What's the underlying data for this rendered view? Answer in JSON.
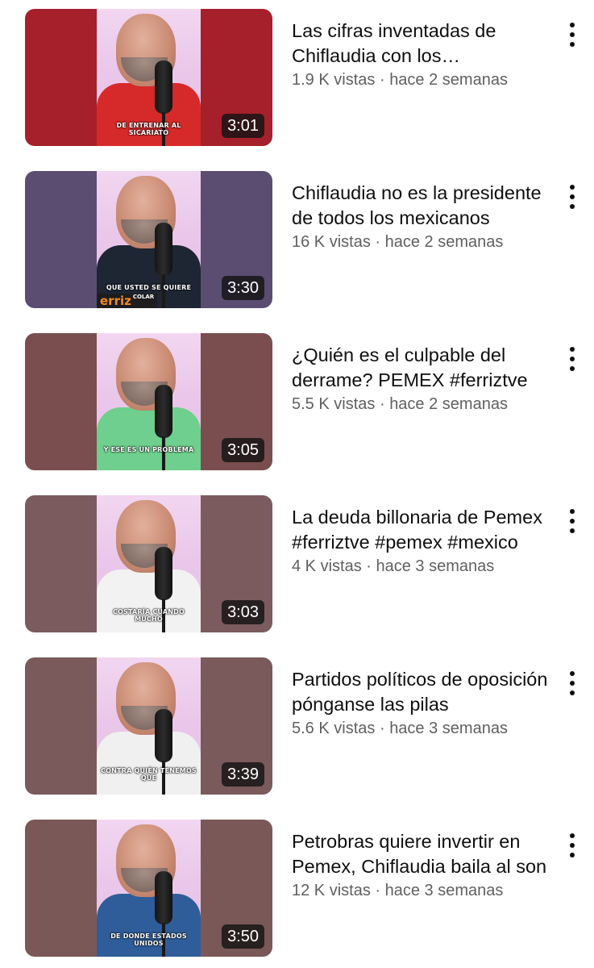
{
  "videos": [
    {
      "title": "Las cifras inventadas de Chiflaudia con los desaparecidos",
      "views": "1.9 K vistas",
      "age": "hace 2 semanas",
      "duration": "3:01",
      "caption": "DE ENTRENAR AL SICARIATO",
      "side_color": "#a5202a",
      "shirt_color": "#d62a2a"
    },
    {
      "title": "Chiflaudia no es la presidente de todos los mexicanos",
      "views": "16 K vistas",
      "age": "hace 2 semanas",
      "duration": "3:30",
      "caption": "QUE USTED SE QUIERE",
      "logo": "erriz",
      "sub_caption": "COLAR",
      "side_color": "#5b4d72",
      "shirt_color": "#1e2533"
    },
    {
      "title": "¿Quién es el culpable del derrame? PEMEX #ferriztve",
      "views": "5.5 K vistas",
      "age": "hace 2 semanas",
      "duration": "3:05",
      "caption": "Y ESE ES UN PROBLEMA",
      "side_color": "#7a4e4e",
      "shirt_color": "#6fcf8e"
    },
    {
      "title": "La deuda billonaria de Pemex #ferriztve #pemex #mexico",
      "views": "4 K vistas",
      "age": "hace 3 semanas",
      "duration": "3:03",
      "caption": "COSTARÍA CUANDO MUCHO",
      "side_color": "#7b5b5d",
      "shirt_color": "#f2f2f2"
    },
    {
      "title": "Partidos políticos de oposición pónganse las pilas",
      "views": "5.6 K vistas",
      "age": "hace 3 semanas",
      "duration": "3:39",
      "caption": "CONTRA QUIÉN TENEMOS QUE",
      "side_color": "#7a5a5b",
      "shirt_color": "#f0f0f0"
    },
    {
      "title": "Petrobras quiere invertir en Pemex, Chiflaudia baila al son",
      "views": "12 K vistas",
      "age": "hace 3 semanas",
      "duration": "3:50",
      "caption": "DE DONDE ESTADOS UNIDOS",
      "side_color": "#7a5857",
      "shirt_color": "#2f5d99"
    }
  ],
  "meta_separator": "·",
  "icons": {
    "more": "more-vertical-icon"
  }
}
